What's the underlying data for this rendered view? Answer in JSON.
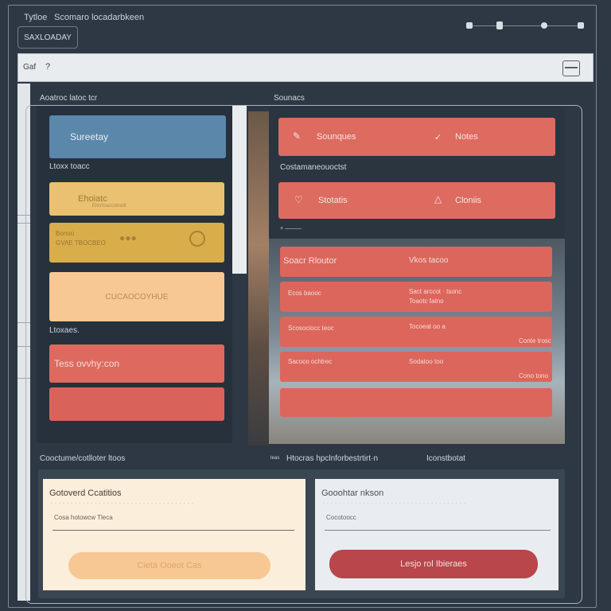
{
  "window": {
    "title_left": "Tytloe",
    "title_right": "Scomaro locadarbkeen",
    "app_badge": "SAXLOADAY"
  },
  "address_bar": {
    "tab_text": "Gaf",
    "help_text": "?"
  },
  "left_panel": {
    "header": "Aoatroc latoc tcr",
    "card_top": "Sureetay",
    "section_mid": "Ltoxx toacc",
    "yellow_cards": [
      {
        "title": "Ehoiatc",
        "subtitle": "Eltcrtoaccstnedt"
      },
      {
        "title": "Bonoo",
        "subtitle": "GVAE TBOCBEO"
      }
    ],
    "peach_card": "CUCAOCOYHUE",
    "section_low": "Ltoxaes.",
    "coral_cards": [
      {
        "title": "Tess ovvhy:con"
      },
      {
        "title": ""
      }
    ]
  },
  "right_panel": {
    "header": "Sounacs",
    "top_cards": [
      {
        "left": "Sounques",
        "right": "Notes"
      },
      {
        "left": "Stotatis",
        "right": "Cloniis"
      }
    ],
    "section_label": "Costamaneouoctst",
    "plus_text": "+ ———",
    "rows": [
      {
        "title": "Soacr Rloutor",
        "right": "Vkos tacoo"
      },
      {
        "left1": "Ecos baooc",
        "right1": "Sact arccot · tsonc",
        "left2": "",
        "right2": "Toaotc fatno"
      },
      {
        "left1": "Scosociocc teoc",
        "right1": "Tocoeat oo a",
        "left2": "",
        "right2": "Conte trosc"
      },
      {
        "left1": "Sacoco ochtrec",
        "right1": "Sodatoo too",
        "left2": "",
        "right2": "Cono tono"
      },
      {
        "left1": "",
        "right1": ""
      }
    ]
  },
  "bottom": {
    "left_label": "Cooctume/cotlloter ltoos",
    "mid_label": "Htocras hpclnforbestrtirt·n",
    "right_label": "Iconstbotat",
    "mid_prefix": "teas",
    "left_form": {
      "title": "Gotoverd Ccatitios",
      "hint": "- - - - - - - - - - - - - - - - - - - - - - - - - - - - - - - - - - - -",
      "field": "Cosa hotowcw Tleca",
      "button": "Cieta Ooeot Cas"
    },
    "right_form": {
      "title": "Gooohtar nkson",
      "hint": "- - - - - - - - - - - - - - - - - - - - - - - - - - - - - - - - - - - -",
      "field": "Cocotoocc",
      "button": "Lesjo rol Ibieraes"
    }
  },
  "colors": {
    "background": "#2d3844",
    "accent_salmon": "#dd6b60",
    "accent_yellow": "#e8c06e",
    "accent_peach": "#f7c894",
    "accent_blue": "#5a87aa",
    "button_red": "#b9464a"
  }
}
